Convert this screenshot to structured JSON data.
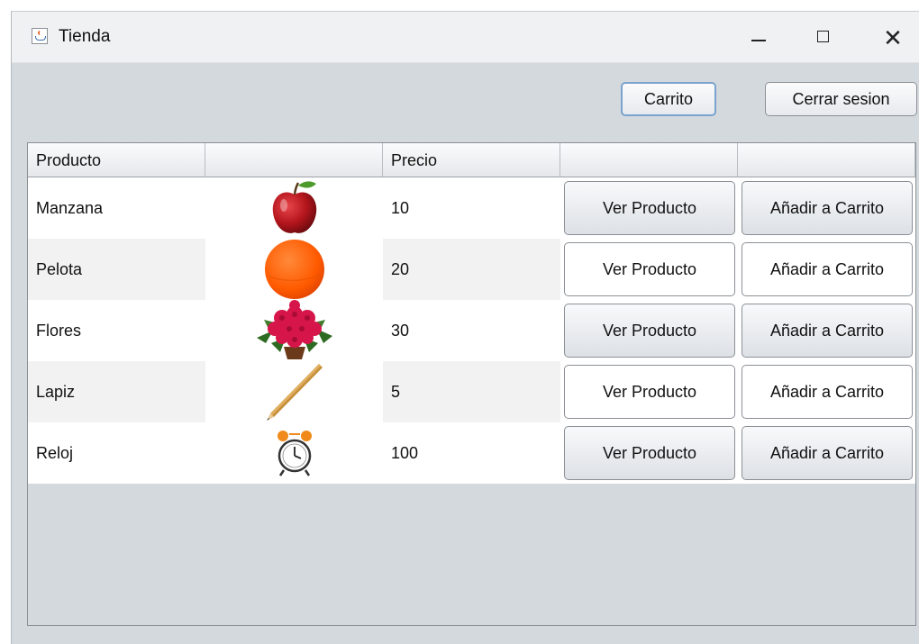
{
  "window": {
    "title": "Tienda",
    "close_glyph": "✕"
  },
  "toolbar": {
    "cart_button": "Carrito",
    "logout_button": "Cerrar sesion"
  },
  "table": {
    "columns": [
      "Producto",
      "",
      "Precio",
      "",
      ""
    ],
    "rows": [
      {
        "product": "Manzana",
        "image_icon": "apple-icon",
        "price": "10",
        "view_label": "Ver Producto",
        "add_label": "Añadir a Carrito"
      },
      {
        "product": "Pelota",
        "image_icon": "ball-icon",
        "price": "20",
        "view_label": "Ver Producto",
        "add_label": "Añadir a Carrito"
      },
      {
        "product": "Flores",
        "image_icon": "flowers-icon",
        "price": "30",
        "view_label": "Ver Producto",
        "add_label": "Añadir a Carrito"
      },
      {
        "product": "Lapiz",
        "image_icon": "pencil-icon",
        "price": "5",
        "view_label": "Ver Producto",
        "add_label": "Añadir a Carrito"
      },
      {
        "product": "Reloj",
        "image_icon": "clock-icon",
        "price": "100",
        "view_label": "Ver Producto",
        "add_label": "Añadir a Carrito"
      }
    ]
  },
  "colors": {
    "window_background": "#d4d9de",
    "titlebar_background": "#f0f1f3",
    "focused_button_border": "#7aa3cf"
  }
}
